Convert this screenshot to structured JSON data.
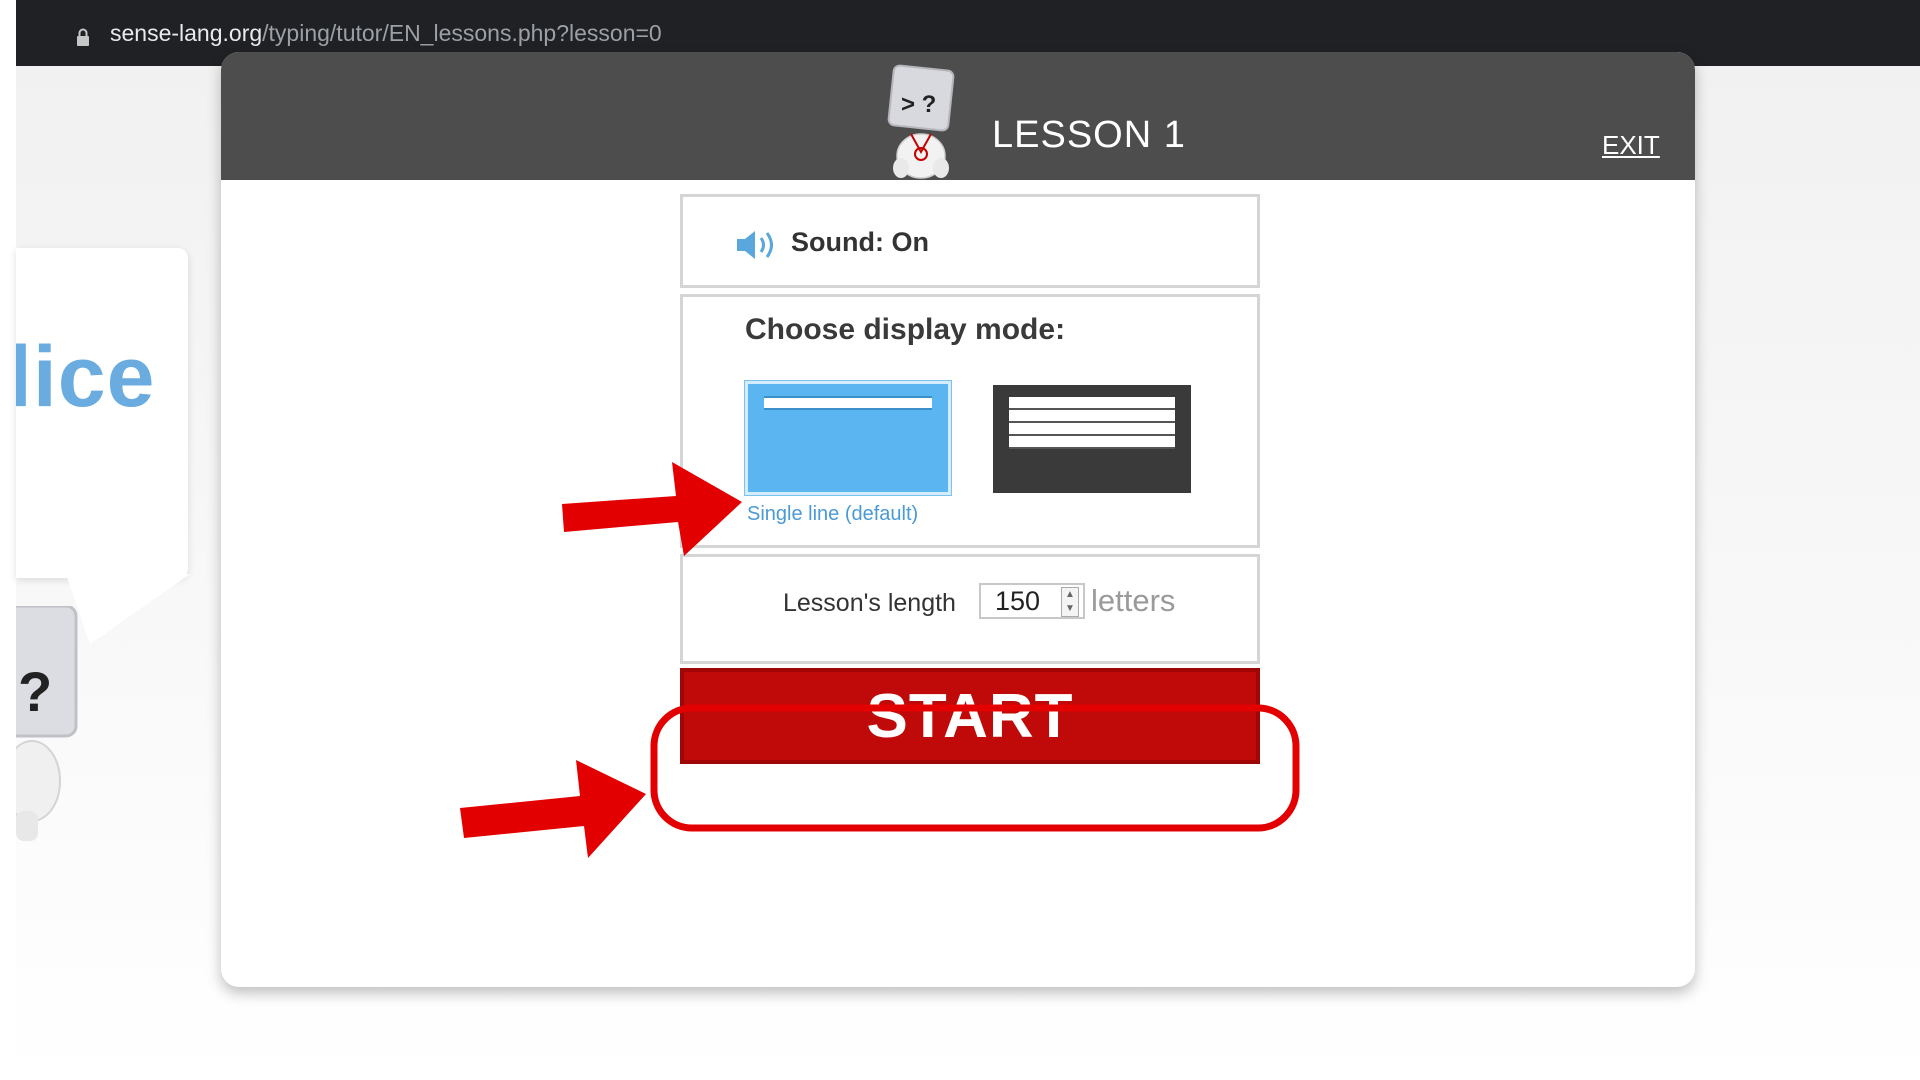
{
  "browser": {
    "url_domain": "sense-lang.org",
    "url_path": "/typing/tutor/EN_lessons.php?lesson=0"
  },
  "background": {
    "bubble_text": "lice",
    "mascot_glyph": "?"
  },
  "modal": {
    "title": "LESSON 1",
    "exit_label": "EXIT",
    "mascot_glyphs": "> ?",
    "sound_label": "Sound: On",
    "display_mode_title": "Choose display mode:",
    "single_line_caption": "Single line (default)",
    "length_label": "Lesson's length",
    "length_value": "150",
    "length_unit": "letters",
    "start_label": "START"
  },
  "colors": {
    "header_bg": "#4d4d4d",
    "start_red": "#c00a0a",
    "mode_blue": "#5ab5f0",
    "annotation_red": "#e30000"
  },
  "icons": [
    "lock-icon",
    "speaker-icon",
    "mascot-icon",
    "spinner-arrows-icon"
  ]
}
